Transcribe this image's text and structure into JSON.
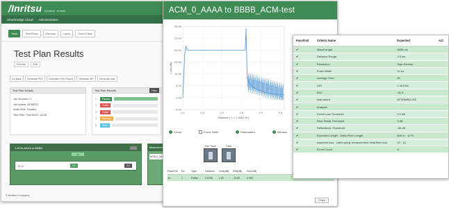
{
  "anritsu_app": {
    "logo": "/Inritsu",
    "logo_tagline": "envision : ensure",
    "nav": [
      "Shortmedge Cloud",
      "Administration"
    ],
    "toolbar": [
      "Tests",
      "Test Plans",
      "Devices",
      "Users",
      "Event Cfws"
    ],
    "page_title": "Test Plan Results",
    "sub_buttons": [
      "Results",
      "Edit"
    ],
    "actions": [
      "Go Back",
      "Generate PDF",
      "Generate CSV Report",
      "Generate ZIP",
      "Generate Instr"
    ],
    "details_header": "Test Plan Details",
    "details": [
      "Job Number: 1",
      "Job Name: ACME2C",
      "Work Res: Cavalry",
      "Test Plan: Test ACM - ACM"
    ],
    "results_header": "Test Plan Results",
    "results_chip": "Filter",
    "results": [
      {
        "n": "1",
        "label": "Passed",
        "status": "pass"
      },
      {
        "n": "2",
        "label": "Failed",
        "status": "fail"
      },
      {
        "n": "3",
        "label": "Failed",
        "status": "fail"
      },
      {
        "n": "4",
        "label": "Warning",
        "status": "warn"
      },
      {
        "n": "5",
        "label": "None",
        "status": "info"
      }
    ],
    "green_box": {
      "header": "1 ACM-AAAA to BBBB",
      "pill": "0/1",
      "row_label": "0 / 0",
      "tag": "0/1",
      "tag2": "0/1"
    },
    "side_box": {
      "header": "Measurements",
      "value": "ACM_0_AAAA"
    },
    "footer": "© Anritsu Company"
  },
  "otdr_window": {
    "title": "ACM_0_AAAA to BBBB_ACM-test",
    "controls": [
      "Linear",
      "Event Table",
      "Parameters",
      "Window"
    ],
    "thumbs": [
      "Ref. Trace",
      "Trace"
    ],
    "event_header": [
      "Pass/Fail",
      "No.",
      "Type",
      "Distance",
      "Loss(dB)",
      "Refl(dB)",
      "Sum(dB)"
    ],
    "event_row": [
      "ok",
      "1",
      "Reflec",
      "0.0238",
      "1.82",
      "-15.82",
      "0.000"
    ],
    "close_label": "Close",
    "chart_y_label": "Loss (dB)",
    "chart_x_label": "Distance ( 1 = 2.0000 m )"
  },
  "chart_data": {
    "type": "line",
    "ylabel": "Loss (dB)",
    "xlabel": "Distance ( 1 = 2.0000 m )",
    "yticks": [
      "30.00",
      "25.00",
      "20.00",
      "15.00",
      "10.00",
      "5.00",
      "0.00",
      "-5.00"
    ],
    "xticks": [
      "0.0",
      "0.5",
      "1.0",
      "1.5",
      "2.0",
      "2.5"
    ],
    "ylim": [
      -5,
      30
    ],
    "xlim": [
      0,
      2.6
    ],
    "series": [
      {
        "x": [
          0.0,
          0.05,
          0.08,
          0.12,
          0.5,
          1.0,
          1.5,
          1.6,
          1.62,
          1.65,
          1.7,
          1.8,
          1.9,
          2.0,
          2.1,
          2.2,
          2.3,
          2.4,
          2.5,
          2.6
        ],
        "y": [
          0,
          18.5,
          21.5,
          20.0,
          20.0,
          20.0,
          20.0,
          20.0,
          29.0,
          8.0,
          6.0,
          4.5,
          3.5,
          2.8,
          2.2,
          1.8,
          1.6,
          1.4,
          1.3,
          1.2
        ]
      }
    ]
  },
  "criteria": {
    "headers": [
      "Pass/Fail",
      "Criteria Name",
      "Expected",
      "Act"
    ],
    "rows": [
      [
        "✔",
        "WaveLength",
        "1650 nm",
        ""
      ],
      [
        "✔",
        "Distance Range",
        "2.5 km",
        ""
      ],
      [
        "✔",
        "Resolution",
        "High Density",
        ""
      ],
      [
        "✔",
        "Pulse Width",
        "10 ns",
        ""
      ],
      [
        "✔",
        "Average Time",
        "30",
        ""
      ],
      [
        "✔",
        "IOR",
        "1.467000",
        ""
      ],
      [
        "✔",
        "BSC",
        "-81.5",
        ""
      ],
      [
        "✔",
        "Instrument",
        "MT9085B2-053",
        ""
      ],
      [
        "✔",
        "Analysis",
        "",
        ""
      ],
      [
        "✔",
        "Event Loss Threshold",
        "0.2 dB",
        ""
      ],
      [
        "✔",
        "Fiber Break Threshold",
        "3 dB",
        ""
      ],
      [
        "✔",
        "Reflectance Threshold",
        "-65 dB",
        ""
      ],
      [
        "✔",
        "Expected Length · Delta Fiber Length",
        "600 m · 10 %",
        ""
      ],
      [
        "✔",
        "expected loss · cable group measurement delta fiber loss",
        "10 · 15",
        ""
      ],
      [
        "✔",
        "Event Count",
        "6",
        ""
      ]
    ]
  },
  "colors": {
    "brand_green": "#3f8b55",
    "row_green": "#c9e9cf",
    "trace_blue": "#5b9bd5"
  }
}
